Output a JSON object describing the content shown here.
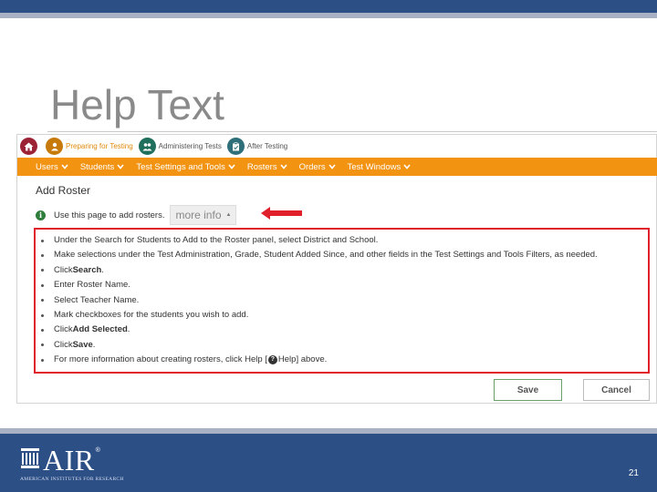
{
  "slide": {
    "title": "Help Text",
    "page_number": "21"
  },
  "colors": {
    "brand_blue": "#2c4f86",
    "nav_orange": "#f29312",
    "highlight_red": "#e0202a"
  },
  "breadcrumbs": [
    {
      "label": "",
      "icon": "home-icon"
    },
    {
      "label": "Preparing for Testing",
      "icon": "user-icon"
    },
    {
      "label": "Administering Tests",
      "icon": "people-icon"
    },
    {
      "label": "After Testing",
      "icon": "clipboard-icon"
    }
  ],
  "nav": [
    {
      "label": "Users"
    },
    {
      "label": "Students"
    },
    {
      "label": "Test Settings and Tools"
    },
    {
      "label": "Rosters"
    },
    {
      "label": "Orders"
    },
    {
      "label": "Test Windows"
    }
  ],
  "page": {
    "heading": "Add Roster",
    "info_text": "Use this page to add rosters.",
    "more_info_label": "more info"
  },
  "help": {
    "item1": "Under the Search for Students to Add to the Roster panel, select District and School.",
    "item2": "Make selections under the Test Administration, Grade, Student Added Since, and other fields in the Test Settings and Tools Filters, as needed.",
    "item3_pre": "Click ",
    "item3_bold": "Search",
    "item3_post": ".",
    "item4": "Enter Roster Name.",
    "item5": "Select Teacher Name.",
    "item6": "Mark checkboxes for the students you wish to add.",
    "item7_pre": "Click ",
    "item7_bold": "Add Selected",
    "item7_post": ".",
    "item8_pre": "Click ",
    "item8_bold": "Save",
    "item8_post": ".",
    "item9_pre": "For more information about creating rosters, click Help [",
    "item9_post": " Help] above."
  },
  "buttons": {
    "save": "Save",
    "cancel": "Cancel"
  },
  "footer": {
    "logo_text": "AIR",
    "logo_reg": "®",
    "logo_sub": "AMERICAN INSTITUTES FOR RESEARCH"
  }
}
